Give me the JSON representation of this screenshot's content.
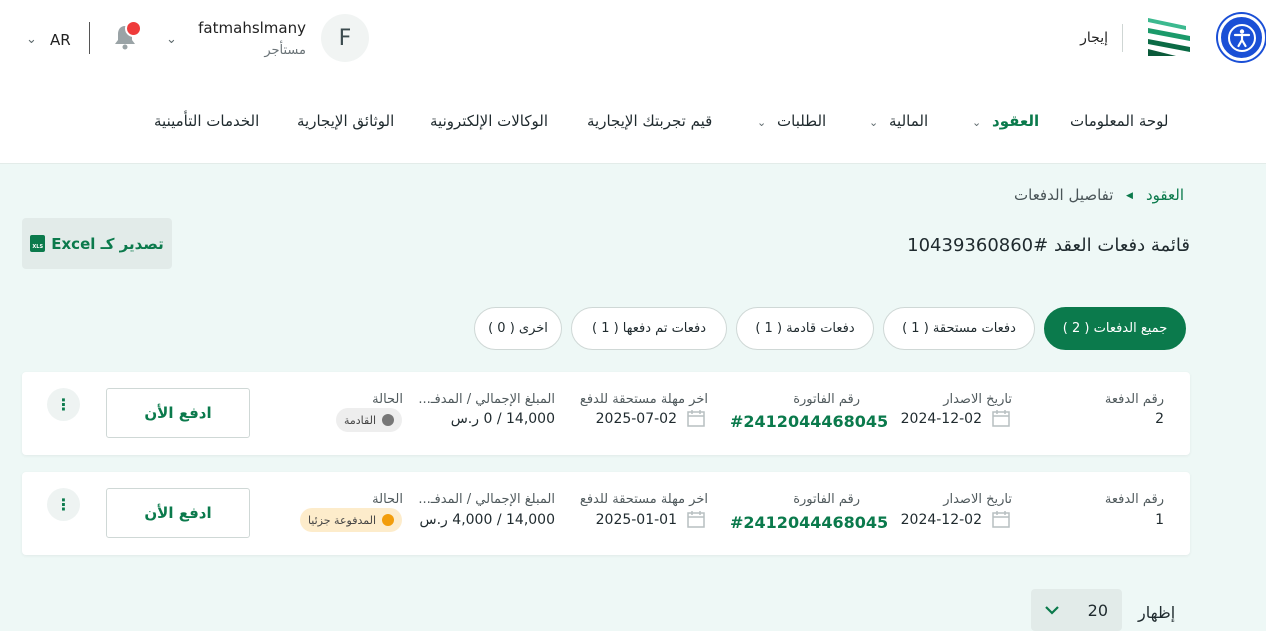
{
  "header": {
    "brand": "إيجار",
    "user": {
      "initial": "F",
      "name": "fatmahslmany",
      "role": "مستأجر"
    },
    "language": "AR",
    "colors": {
      "accent": "#0b7a4c",
      "a11y": "#1a4fd6",
      "notification": "#ef3b3b"
    }
  },
  "nav": {
    "items": [
      {
        "label": "لوحة المعلومات"
      },
      {
        "label": "العقود"
      },
      {
        "label": "المالية"
      },
      {
        "label": "الطلبات"
      },
      {
        "label": "قيم تجربتك الإيجارية"
      },
      {
        "label": "الوكالات الإلكترونية"
      },
      {
        "label": "الوثائق الإيجارية"
      },
      {
        "label": "الخدمات التأمينية"
      }
    ]
  },
  "breadcrumb": {
    "parent": "العقود",
    "current": "تفاصيل الدفعات"
  },
  "page": {
    "title": "قائمة دفعات العقد #10439360860",
    "export_label": "تصدير كـ Excel",
    "export_icon_text": "XLS"
  },
  "filters": [
    {
      "label": "جميع الدفعات ( 2 )"
    },
    {
      "label": "دفعات مستحقة ( 1 )"
    },
    {
      "label": "دفعات قادمة ( 1 )"
    },
    {
      "label": "دفعات تم دفعها ( 1 )"
    },
    {
      "label": "اخرى ( 0 )"
    }
  ],
  "columns": {
    "number": "رقم الدفعة",
    "issue_date": "تاريخ الاصدار",
    "invoice": "رقم الفاتورة",
    "due": "اخر مهلة مستحقة للدفع",
    "amount": "المبلغ الإجمالي / المدفـ...",
    "status": "الحالة"
  },
  "payments": [
    {
      "number": "2",
      "issue_date": "2024-12-02",
      "invoice": "#2412044468045",
      "due": "2025-07-02",
      "amount": "14,000 / 0 ر.س",
      "status": "القادمة",
      "status_color": "#777777",
      "status_bg": "#eeeeee",
      "pay_label": "ادفع الأن",
      "menu_icon": "⋮"
    },
    {
      "number": "1",
      "issue_date": "2024-12-02",
      "invoice": "#2412044468045",
      "due": "2025-01-01",
      "amount": "14,000 / 4,000 ر.س",
      "status": "المدفوعة جزئيا",
      "status_color": "#f29d0b",
      "status_bg": "#fdeccb",
      "pay_label": "ادفع الأن",
      "menu_icon": "⋮"
    }
  ],
  "pagination": {
    "show_label": "إظهار",
    "page_size": "20"
  }
}
